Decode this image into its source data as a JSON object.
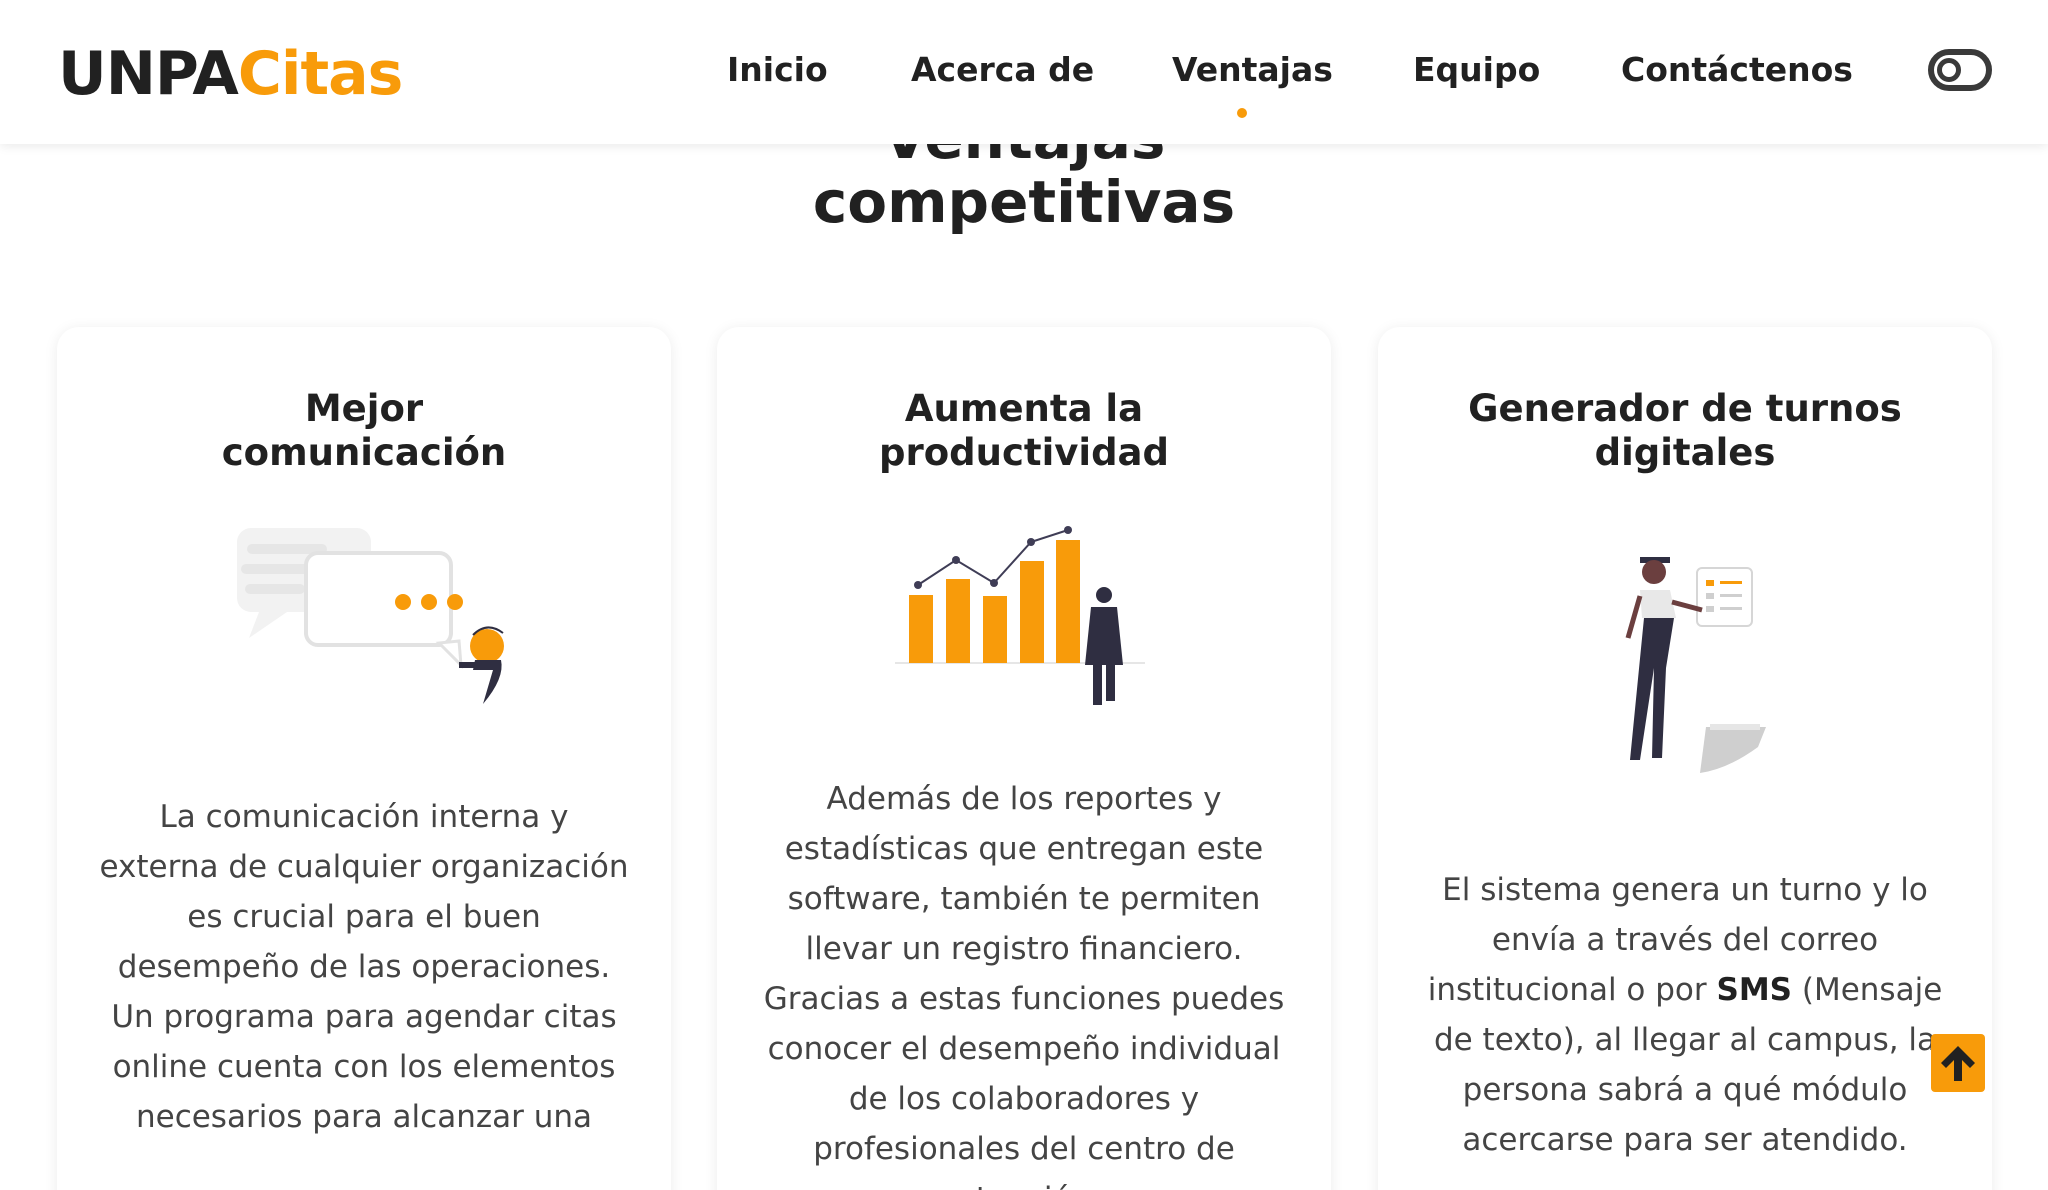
{
  "brand": {
    "part1": "UNPA",
    "part2": "Citas"
  },
  "nav": {
    "items": [
      {
        "label": "Inicio"
      },
      {
        "label": "Acerca de"
      },
      {
        "label": "Ventajas"
      },
      {
        "label": "Equipo"
      },
      {
        "label": "Contáctenos"
      }
    ],
    "active": "Ventajas",
    "theme_toggle_icon": "toggle-switch-icon"
  },
  "section": {
    "title_line1": "Ventajas",
    "title_line2": "competitivas"
  },
  "cards": [
    {
      "title_line1": "Mejor",
      "title_line2": "comunicación",
      "illustration": "chat-bubbles-illustration",
      "text": "La comunicación interna y externa de cualquier organización es crucial para el buen desempeño de las operaciones. Un programa para agendar citas online cuenta con los elementos necesarios para alcanzar una"
    },
    {
      "title_line1": "Aumenta la",
      "title_line2": "productividad",
      "illustration": "growth-chart-illustration",
      "text": "Además de los reportes y estadísticas que entregan este software, también te permiten llevar un registro financiero. Gracias a estas funciones puedes conocer el desempeño individual de los colaboradores y profesionales del centro de atención"
    },
    {
      "title_line1": "Generador de turnos",
      "title_line2": "digitales",
      "illustration": "checklist-person-illustration",
      "text_before": "El sistema genera un turno y lo envía a través del correo institucional o por ",
      "text_bold": "SMS",
      "text_after": " (Mensaje de texto), al llegar al campus, la persona sabrá a qué módulo acercarse para ser atendido."
    }
  ],
  "colors": {
    "accent": "#f89b0a",
    "text_dark": "#212121",
    "text_body": "#444444",
    "figure_dark": "#2f2e41"
  },
  "scroll_top_icon": "arrow-up-icon"
}
